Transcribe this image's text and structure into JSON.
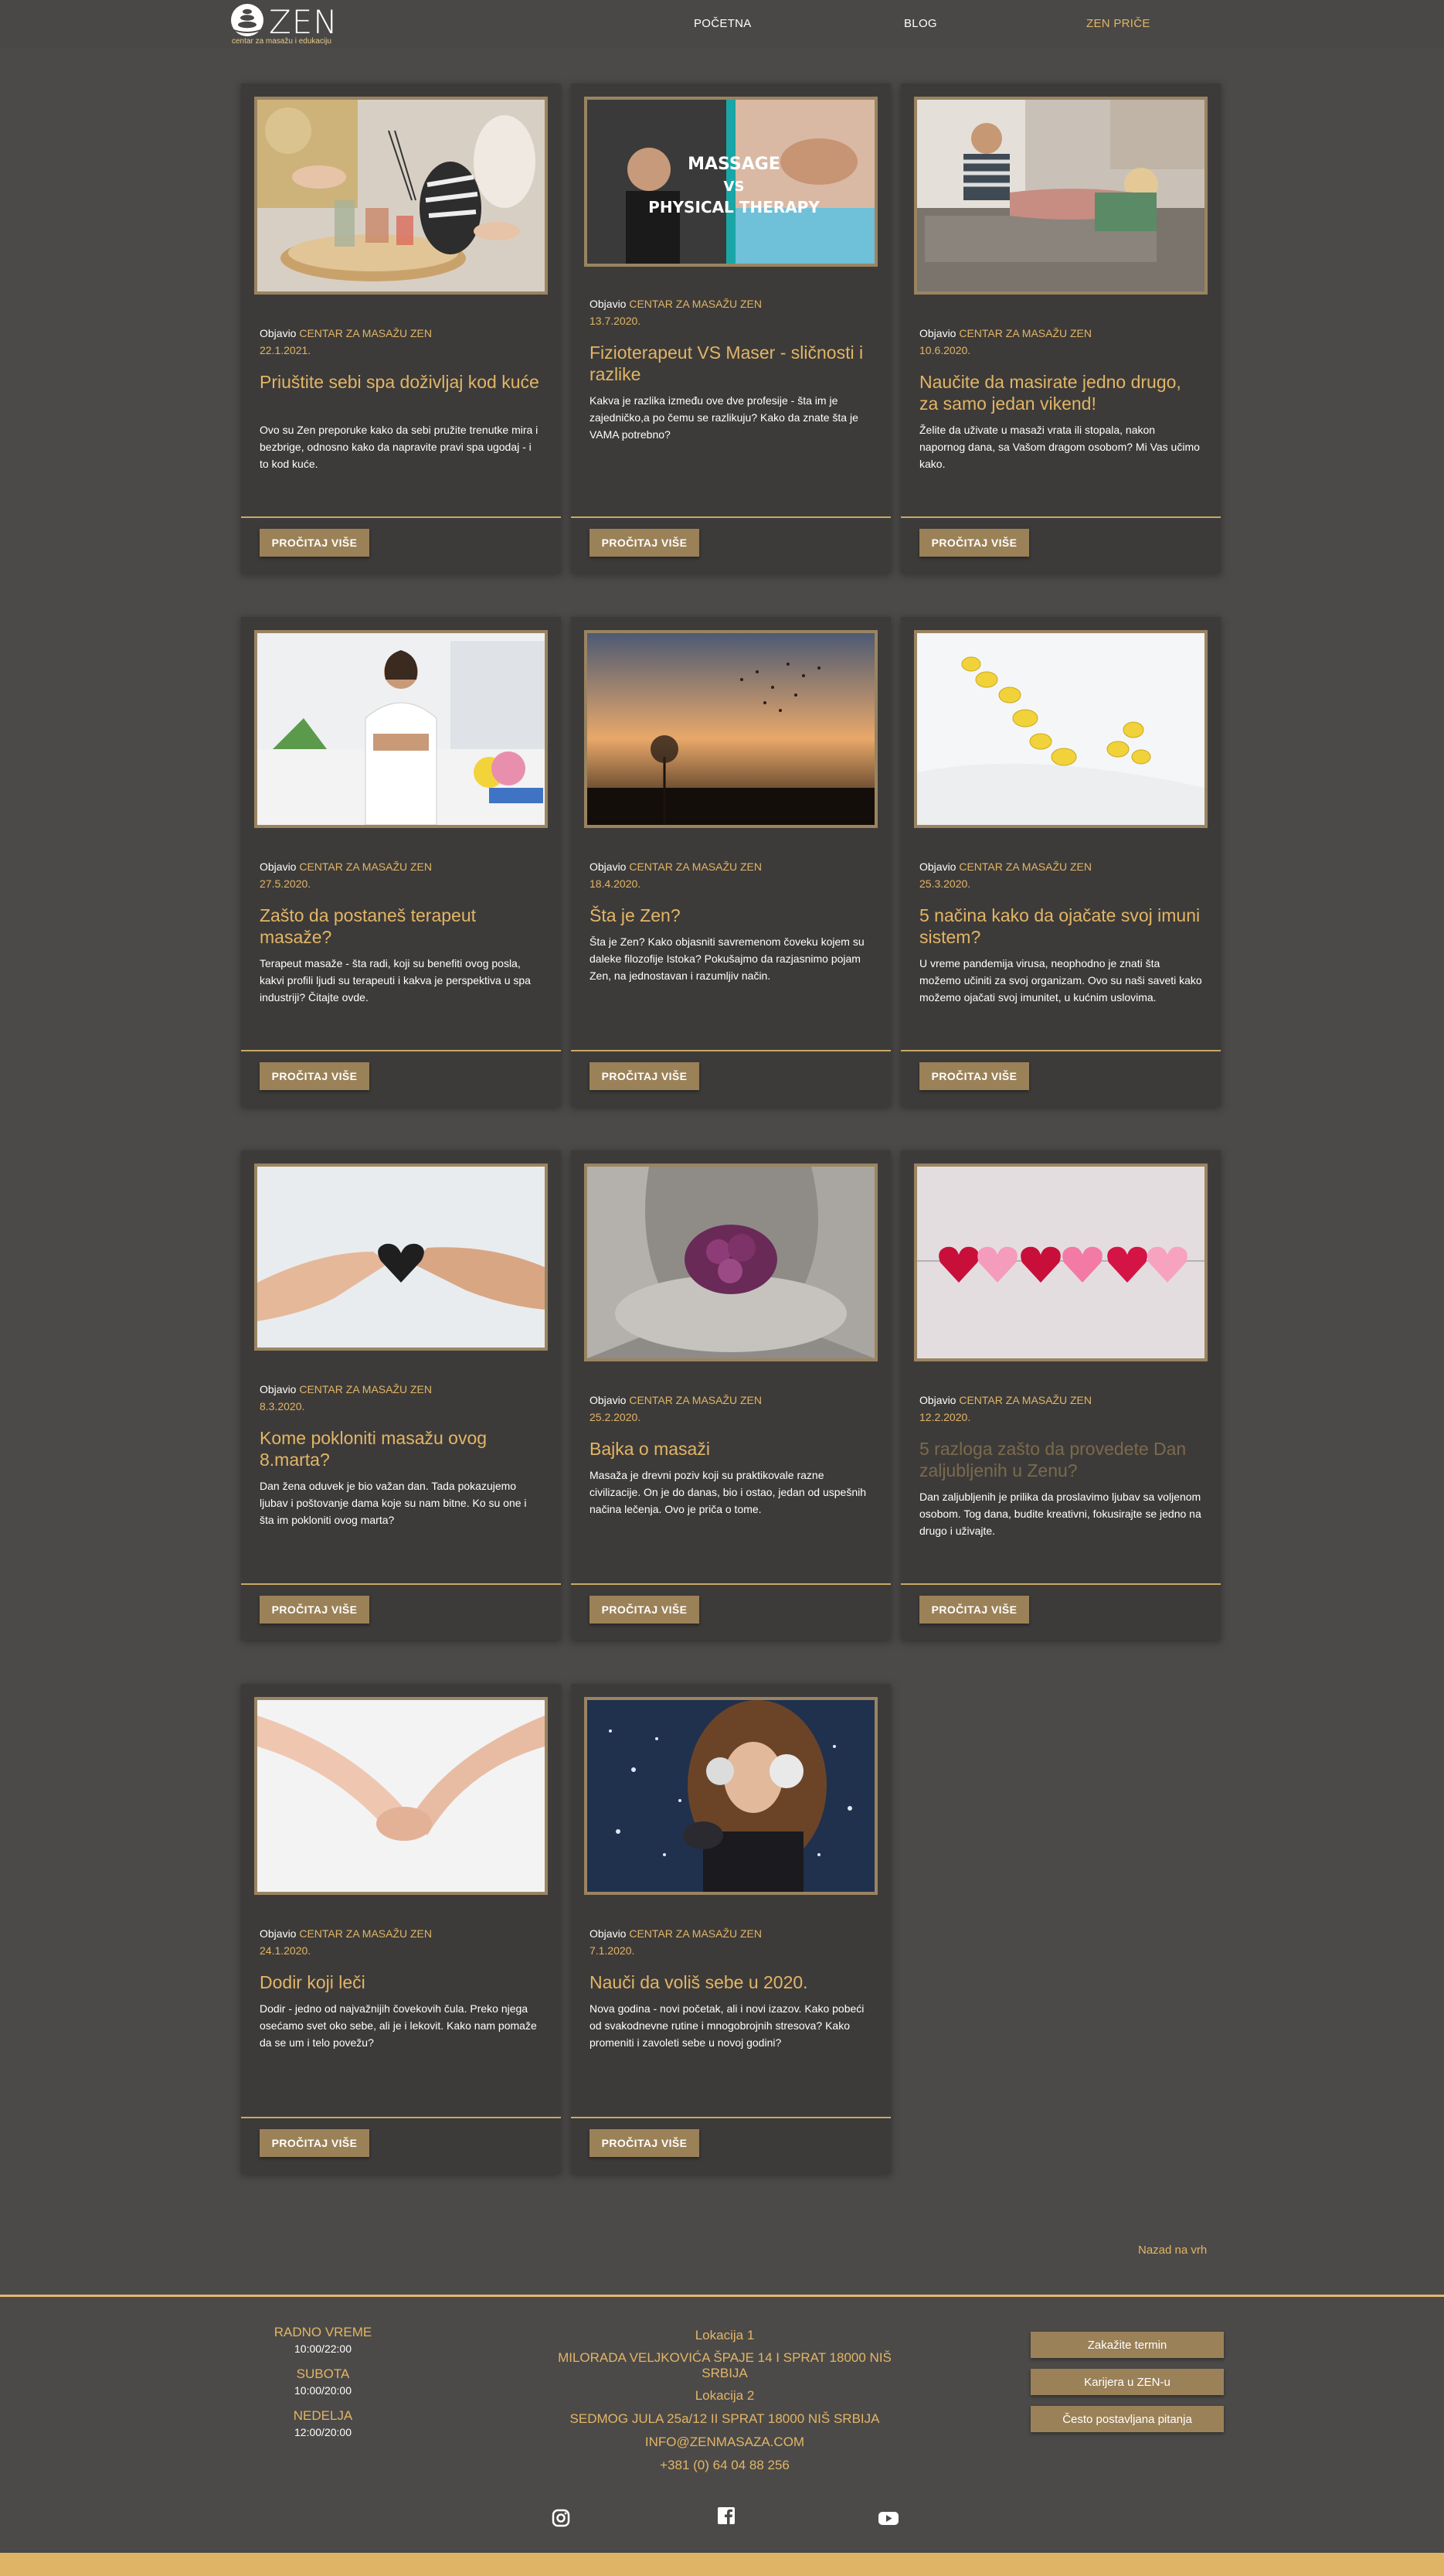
{
  "header": {
    "logo_word": "ZEN",
    "logo_tagline": "centar za masažu i edukaciju",
    "nav": [
      {
        "label": "POČETNA",
        "active": false
      },
      {
        "label": "BLOG",
        "active": false
      },
      {
        "label": "ZEN PRIČE",
        "active": true
      }
    ]
  },
  "posts": [
    {
      "by": "Objavio",
      "author": "CENTAR ZA MASAŽU ZEN",
      "date": "22.1.2021.",
      "title": "Priuštite sebi spa doživljaj kod kuće",
      "excerpt": "Ovo su Zen preporuke kako da sebi pružite trenutke mira i bezbrige, odnosno kako da napravite pravi spa ugodaj - i to kod kuće.",
      "button": "PROČITAJ VIŠE"
    },
    {
      "by": "Objavio",
      "author": "CENTAR ZA MASAŽU ZEN",
      "date": "13.7.2020.",
      "title": "Fizioterapeut VS Maser - sličnosti i razlike",
      "excerpt": "Kakva je razlika između ove dve profesije - šta im je zajedničko,a po čemu se razlikuju? Kako da znate šta je VAMA potrebno?",
      "button": "PROČITAJ VIŠE",
      "image_text": [
        "MASSAGE",
        "VS",
        "PHYSICAL THERAPY"
      ]
    },
    {
      "by": "Objavio",
      "author": "CENTAR ZA MASAŽU ZEN",
      "date": "10.6.2020.",
      "title": "Naučite da masirate jedno drugo, za samo jedan vikend!",
      "excerpt": "Želite da uživate u masaži vrata ili stopala, nakon napornog dana, sa Vašom dragom osobom? Mi Vas učimo kako.",
      "button": "PROČITAJ VIŠE"
    },
    {
      "by": "Objavio",
      "author": "CENTAR ZA MASAŽU ZEN",
      "date": "27.5.2020.",
      "title": "Zašto da postaneš terapeut masaže?",
      "excerpt": "Terapeut masaže - šta radi, koji su benefiti ovog posla, kakvi profili ljudi su terapeuti i kakva je perspektiva u spa industriji? Čitajte ovde.",
      "button": "PROČITAJ VIŠE"
    },
    {
      "by": "Objavio",
      "author": "CENTAR ZA MASAŽU ZEN",
      "date": "18.4.2020.",
      "title": "Šta je Zen?",
      "excerpt": "Šta je Zen? Kako objasniti savremenom čoveku kojem su daleke filozofije Istoka? Pokušajmo da razjasnimo pojam Zen, na jednostavan i razumljiv način.",
      "button": "PROČITAJ VIŠE"
    },
    {
      "by": "Objavio",
      "author": "CENTAR ZA MASAŽU ZEN",
      "date": "25.3.2020.",
      "title": "5 načina kako da ojačate svoj imuni sistem?",
      "excerpt": "U vreme pandemija virusa, neophodno je znati šta možemo učiniti za svoj organizam. Ovo su naši saveti kako možemo ojačati svoj imunitet, u kućnim uslovima.",
      "button": "PROČITAJ VIŠE"
    },
    {
      "by": "Objavio",
      "author": "CENTAR ZA MASAŽU ZEN",
      "date": "8.3.2020.",
      "title": "Kome pokloniti masažu ovog 8.marta?",
      "excerpt": "Dan žena oduvek je bio važan dan. Tada pokazujemo ljubav i poštovanje dama koje su nam bitne. Ko su one i šta im pokloniti ovog marta?",
      "button": "PROČITAJ VIŠE"
    },
    {
      "by": "Objavio",
      "author": "CENTAR ZA MASAŽU ZEN",
      "date": "25.2.2020.",
      "title": "Bajka o masaži",
      "excerpt": "Masaža je drevni poziv koji su praktikovale razne civilizacije. On je do danas, bio i ostao, jedan od uspešnih načina lečenja. Ovo je priča o tome.",
      "button": "PROČITAJ VIŠE"
    },
    {
      "by": "Objavio",
      "author": "CENTAR ZA MASAŽU ZEN",
      "date": "12.2.2020.",
      "title": "5 razloga zašto da provedete Dan zaljubljenih u Zenu?",
      "excerpt": "Dan zaljubljenih je prilika da proslavimo ljubav sa voljenom osobom. Tog dana, budite kreativni, fokusirajte se jedno na drugo i uživajte.",
      "button": "PROČITAJ VIŠE",
      "dim_title": true
    },
    {
      "by": "Objavio",
      "author": "CENTAR ZA MASAŽU ZEN",
      "date": "24.1.2020.",
      "title": "Dodir koji leči",
      "excerpt": "Dodir - jedno od najvažnijih čovekovih čula. Preko njega osećamo svet oko sebe, ali je i lekovit. Kako nam pomaže da se um i telo povežu?",
      "button": "PROČITAJ VIŠE"
    },
    {
      "by": "Objavio",
      "author": "CENTAR ZA MASAŽU ZEN",
      "date": "7.1.2020.",
      "title": "Nauči da voliš sebe u 2020.",
      "excerpt": "Nova godina - novi početak, ali i novi izazov. Kako pobeći od svakodnevne rutine i mnogobrojnih stresova? Kako promeniti i zavoleti sebe u novoj godini?",
      "button": "PROČITAJ VIŠE"
    }
  ],
  "back_to_top": "Nazad na vrh",
  "footer": {
    "hours": [
      {
        "label": "RADNO VREME",
        "value": "10:00/22:00"
      },
      {
        "label": "SUBOTA",
        "value": "10:00/20:00"
      },
      {
        "label": "NEDELJA",
        "value": "12:00/20:00"
      }
    ],
    "location1_label": "Lokacija 1",
    "location1_address": "MILORADA VELJKOVIĆA ŠPAJE 14 I SPRAT 18000 NIŠ SRBIJA",
    "location2_label": "Lokacija 2",
    "location2_address": "SEDMOG JULA 25a/12 II SPRAT 18000 NIŠ SRBIJA",
    "email": "INFO@ZENMASAZA.COM",
    "phone": "+381 (0) 64 04 88 256",
    "buttons": [
      "Zakažite termin",
      "Karijera u ZEN-u",
      "Često postavljana pitanja"
    ],
    "social": [
      "instagram-icon",
      "facebook-icon",
      "youtube-icon"
    ]
  },
  "colors": {
    "background": "#4c4a48",
    "card": "#3d3b39",
    "accent": "#e2b566",
    "button": "#9b8158"
  }
}
